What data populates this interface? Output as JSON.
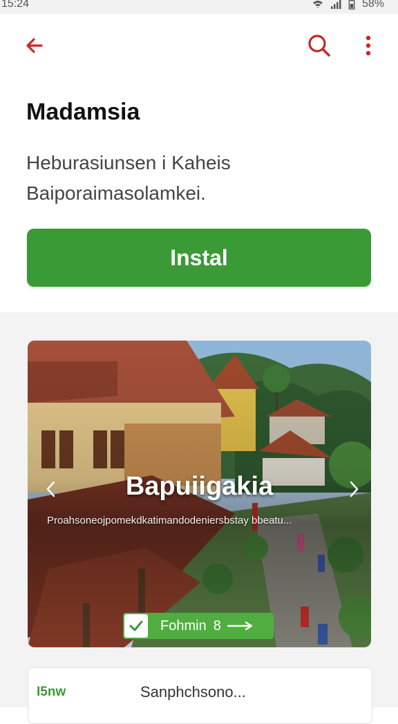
{
  "status_bar": {
    "time": "15:24",
    "battery": "58%",
    "icons": [
      "wifi-icon",
      "signal-icon",
      "battery-icon"
    ]
  },
  "toolbar": {
    "back_icon": "arrow-left-icon",
    "search_icon": "search-icon",
    "more_icon": "more-vert-icon",
    "accent_color": "#c62828"
  },
  "app": {
    "title": "Madamsia",
    "description_line1": "Heburasiunsen i Kaheis",
    "description_line2": "Baiporaimasolamkei."
  },
  "install": {
    "label": "Instal",
    "color": "#3a9a36"
  },
  "gallery": {
    "card_title": "Bapuiigakia",
    "card_subtitle": "Proahsoneojpomekdkatimandodeniersbstay bbeatu...",
    "button_label": "Fohmin",
    "button_suffix": "8",
    "prev_icon": "chevron-left-icon",
    "next_icon": "chevron-right-icon",
    "check_icon": "check-icon"
  },
  "bottom": {
    "left_label": "I5nw",
    "right_label": "Sanphchsono..."
  }
}
